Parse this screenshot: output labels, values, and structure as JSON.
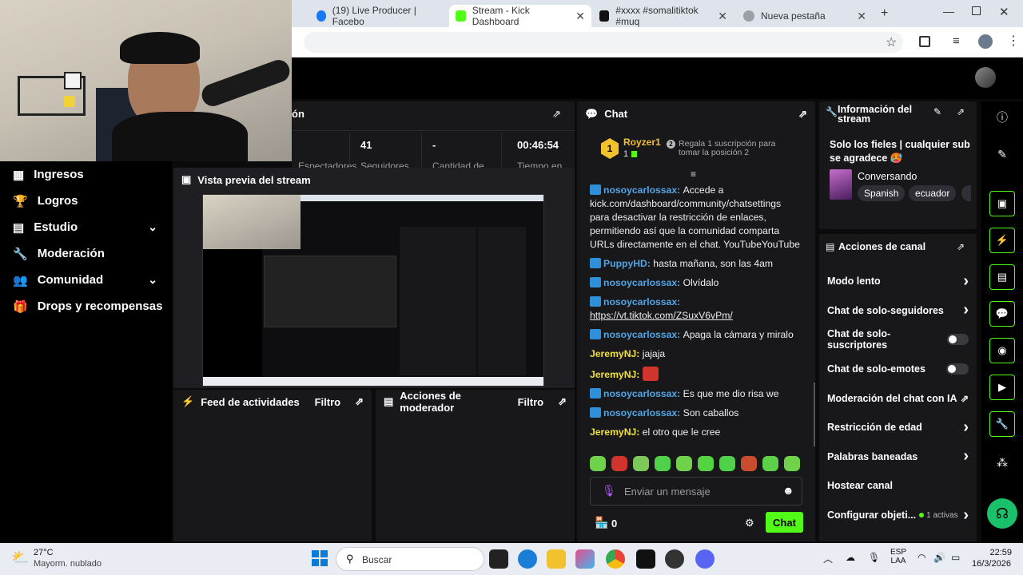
{
  "browser": {
    "tabs": [
      {
        "title": "(19) Live Producer | Facebo"
      },
      {
        "title": "Stream - Kick Dashboard"
      },
      {
        "title": "#xxxx #somalitiktok #muq"
      },
      {
        "title": "Nueva pestaña"
      }
    ]
  },
  "sidebar": {
    "items": [
      {
        "label": "Ingresos",
        "icon": "revenue-icon"
      },
      {
        "label": "Logros",
        "icon": "trophy-icon"
      },
      {
        "label": "Estudio",
        "icon": "studio-icon"
      },
      {
        "label": "Moderación",
        "icon": "wrench-icon"
      },
      {
        "label": "Comunidad",
        "icon": "community-icon"
      },
      {
        "label": "Drops y recompensas",
        "icon": "drops-icon"
      }
    ]
  },
  "session": {
    "title_partial": "ón",
    "stats": [
      {
        "value": "41",
        "label": "Seguidores"
      },
      {
        "value": "-",
        "label": "Cantidad de"
      },
      {
        "value": "00:46:54",
        "label": "Tiempo en"
      }
    ],
    "cut_label": "Espectadores"
  },
  "preview": {
    "title": "Vista previa del stream"
  },
  "feed": {
    "title": "Feed de actividades",
    "filter": "Filtro"
  },
  "modactions": {
    "title": "Acciones de moderador",
    "filter": "Filtro"
  },
  "chat": {
    "title": "Chat",
    "pinned": {
      "rank": "1",
      "user": "Royzer1",
      "count": "1",
      "promo_num": "2",
      "promo": "Regala 1 suscripción para tomar la posición 2"
    },
    "messages": [
      {
        "user": "nosoycarlossax",
        "badge": true,
        "color": "#53a5e3",
        "text": "Accede a kick.com/dashboard/community/chatsettings para desactivar la restricción de enlaces, permitiendo así que la comunidad comparta URLs directamente en el chat. YouTubeYouTube"
      },
      {
        "user": "PuppyHD",
        "badge": true,
        "color": "#53a5e3",
        "text": "hasta mañana, son las 4am"
      },
      {
        "user": "nosoycarlossax",
        "badge": true,
        "color": "#53a5e3",
        "text": "Olvídalo"
      },
      {
        "user": "nosoycarlossax",
        "badge": true,
        "color": "#53a5e3",
        "text": "https://vt.tiktok.com/ZSuxV6vPm/",
        "link": true
      },
      {
        "user": "nosoycarlossax",
        "badge": true,
        "color": "#53a5e3",
        "text": "Apaga la cámara y miralo"
      },
      {
        "user": "JeremyNJ",
        "badge": false,
        "color": "#f0e043",
        "text": "jajaja"
      },
      {
        "user": "JeremyNJ",
        "badge": false,
        "color": "#f0e043",
        "text": "",
        "emote": true
      },
      {
        "user": "nosoycarlossax",
        "badge": true,
        "color": "#53a5e3",
        "text": "Es que me dio risa we"
      },
      {
        "user": "nosoycarlossax",
        "badge": true,
        "color": "#53a5e3",
        "text": "Son caballos"
      },
      {
        "user": "JeremyNJ",
        "badge": false,
        "color": "#f0e043",
        "text": "el otro que le cree"
      }
    ],
    "input_placeholder": "Enviar un mensaje",
    "points": "0",
    "send": "Chat"
  },
  "streaminfo": {
    "title": "Información del stream",
    "stream_title": "Solo los fieles | cualquier sub se agradece 🥵",
    "category": "Conversando",
    "tags": [
      "Spanish",
      "ecuador"
    ]
  },
  "channelactions": {
    "title": "Acciones de canal",
    "items": [
      {
        "label": "Modo lento",
        "control": "chevron"
      },
      {
        "label": "Chat de solo-seguidores",
        "control": "chevron"
      },
      {
        "label": "Chat de solo-suscriptores",
        "control": "toggle"
      },
      {
        "label": "Chat de solo-emotes",
        "control": "toggle"
      },
      {
        "label": "Moderación del chat con IA",
        "control": "external"
      },
      {
        "label": "Restricción de edad",
        "control": "chevron"
      },
      {
        "label": "Palabras baneadas",
        "control": "chevron"
      },
      {
        "label": "Hostear canal",
        "control": "none"
      },
      {
        "label": "Configurar objeti...",
        "control": "chevron",
        "extra": "1 activas"
      }
    ]
  },
  "taskbar": {
    "weather_temp": "27°C",
    "weather_desc": "Mayorm. nublado",
    "search": "Buscar",
    "lang1": "ESP",
    "lang2": "LAA",
    "time": "22:59",
    "date": "16/3/2026"
  },
  "colors": {
    "accent": "#53fc18",
    "panel": "#18181b",
    "bg": "#0b0b0c"
  }
}
